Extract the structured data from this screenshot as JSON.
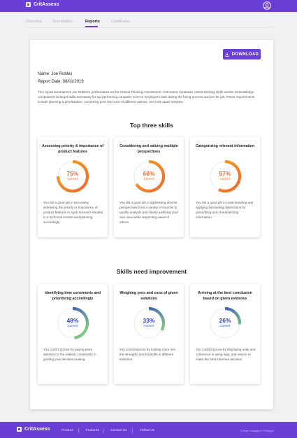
{
  "app": {
    "name": "CritAssess"
  },
  "tabs": [
    {
      "label": "Overview"
    },
    {
      "label": "Test History"
    },
    {
      "label": "Reports"
    },
    {
      "label": "Certificates"
    }
  ],
  "report": {
    "download_label": "DOWNLOAD",
    "name_line": "Name: Joe Robles",
    "date_line": "Report Date: 08/01/2019",
    "summary": "This report summarizes Joe Robles's performance on the Critical Thinking Assessment. CritAssess measures critical thinking skills across 14 knowledge components to target skills necessary for top performing computer science employees both during the hiring process and on the job. These requirements include planning & prioritization, comparing pros and cons of different options, and root cause analysis."
  },
  "top_skills": {
    "title": "Top three skills",
    "color_start": "#f6a623",
    "color_end": "#ef6a2a",
    "items": [
      {
        "title": "Assessing priority & importance of product features",
        "percent": "75%",
        "value": 75,
        "label": "Correct",
        "desc": "You did a good job in accurately assessing the priority or importance of product features in a job scenario situated in a technical context and planning accordingly."
      },
      {
        "title": "Considering and valuing multiple perspectives",
        "percent": "66%",
        "value": 66,
        "label": "Correct",
        "desc": "You did a good job in addressing diverse perspectives from a variety of sources to qualify analysis and clearly justifying your own view while respecting views of others."
      },
      {
        "title": "Categorizing relevant information",
        "percent": "57%",
        "value": 57,
        "label": "Correct",
        "desc": "You did a good job in understanding and applying formulating distinctions for prescribing and characterizing information."
      }
    ]
  },
  "improve_skills": {
    "title": "Skills need improvement",
    "color_start": "#2a3fc7",
    "color_end": "#8ee07a",
    "items": [
      {
        "title": "Identifying time constraints and prioritizing accordingly",
        "percent": "48%",
        "value": 48,
        "label": "Correct",
        "desc": "You could improve by paying more attention to the realistic constraints in guiding your decision making."
      },
      {
        "title": "Weighing pros and cons of given solutions",
        "percent": "33%",
        "value": 33,
        "label": "Correct",
        "desc": "You could improve by looking more into the strengths and tradeoffs in different solutions"
      },
      {
        "title": "Arriving at the best conclusion based on given evidence",
        "percent": "26%",
        "value": 26,
        "label": "Correct",
        "desc": "You could improve by displaying unity and coherence in using logic and reason to make the best informed decision"
      }
    ]
  },
  "footer": {
    "links": [
      "Product",
      "Features",
      "Contact Us",
      "Follow Us"
    ],
    "credit": "© Team Shanyan in Prototype"
  }
}
